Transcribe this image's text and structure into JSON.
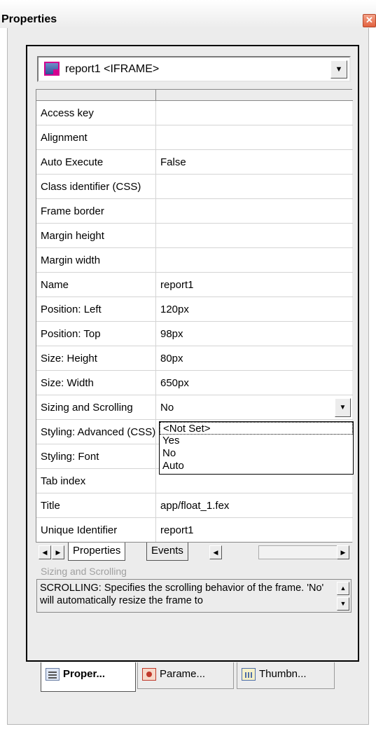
{
  "window": {
    "title": "Properties",
    "close_glyph": "✕"
  },
  "selector": {
    "icon": "iframe-object-icon",
    "value": "report1 <IFRAME>",
    "arrow": "▼"
  },
  "properties": [
    {
      "name": "Access key",
      "value": ""
    },
    {
      "name": "Alignment",
      "value": ""
    },
    {
      "name": "Auto Execute",
      "value": "False"
    },
    {
      "name": "Class identifier (CSS)",
      "value": ""
    },
    {
      "name": "Frame border",
      "value": ""
    },
    {
      "name": "Margin height",
      "value": ""
    },
    {
      "name": "Margin width",
      "value": ""
    },
    {
      "name": "Name",
      "value": "report1"
    },
    {
      "name": "Position: Left",
      "value": "120px"
    },
    {
      "name": "Position: Top",
      "value": "98px"
    },
    {
      "name": "Size: Height",
      "value": "80px"
    },
    {
      "name": "Size: Width",
      "value": "650px"
    },
    {
      "name": "Sizing and Scrolling",
      "value": "No"
    },
    {
      "name": "Styling: Advanced (CSS)",
      "value": ""
    },
    {
      "name": "Styling: Font",
      "value": ""
    },
    {
      "name": "Tab index",
      "value": ""
    },
    {
      "name": "Title",
      "value": "app/float_1.fex"
    },
    {
      "name": "Unique Identifier",
      "value": "report1"
    }
  ],
  "dropdown": {
    "arrow": "▼",
    "options": [
      "<Not Set>",
      "Yes",
      "No",
      "Auto"
    ],
    "highlighted": "<Not Set>"
  },
  "tabs": {
    "left": "◀",
    "right": "▶",
    "items": [
      "Properties",
      "Events"
    ],
    "active": "Properties"
  },
  "description": {
    "title": "Sizing and Scrolling",
    "text": "SCROLLING: Specifies the scrolling behavior of the frame. 'No' will automatically resize the frame to",
    "up": "▲",
    "down": "▼"
  },
  "bottom_tabs": [
    {
      "label": "Proper...",
      "icon": "properties-icon",
      "active": true
    },
    {
      "label": "Parame...",
      "icon": "parameters-icon",
      "active": false
    },
    {
      "label": "Thumbn...",
      "icon": "thumbnails-icon",
      "active": false
    }
  ]
}
